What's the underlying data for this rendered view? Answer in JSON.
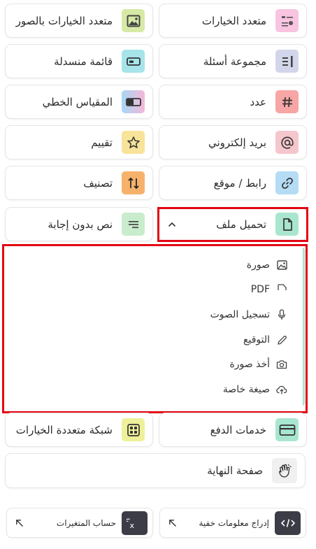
{
  "question_types": {
    "multiple_choice": {
      "label": "متعدد الخيارات",
      "icon": "multiple-choice-icon",
      "color": "#f8c4e0"
    },
    "picture_choice": {
      "label": "متعدد الخيارات بالصور",
      "icon": "image-icon",
      "color": "#d6eaa6"
    },
    "question_group": {
      "label": "مجموعة أسئلة",
      "icon": "question-group-icon",
      "color": "#d3d6ea"
    },
    "dropdown": {
      "label": "قائمة منسدلة",
      "icon": "dropdown-icon",
      "color": "#a6e4ea"
    },
    "number": {
      "label": "عدد",
      "icon": "hash-icon",
      "color": "#f8a5a5"
    },
    "linear_scale": {
      "label": "المقياس الخطي",
      "icon": "linear-scale-icon"
    },
    "email": {
      "label": "بريد إلكتروني",
      "icon": "at-icon",
      "color": "#f5c6cc"
    },
    "rating": {
      "label": "تقييم",
      "icon": "star-icon",
      "color": "#f8e39a"
    },
    "url": {
      "label": "رابط / موقع",
      "icon": "link-icon",
      "color": "#b5dcf5"
    },
    "ranking": {
      "label": "تصنيف",
      "icon": "sort-arrows-icon",
      "color": "#f6b26b"
    },
    "file_upload": {
      "label": "تحميل ملف",
      "icon": "file-icon",
      "color": "#a8e6cf",
      "expanded": true
    },
    "statement": {
      "label": "نص بدون إجابة",
      "icon": "text-lines-icon",
      "color": "#c8eccc"
    }
  },
  "file_upload_options": [
    {
      "label": "صورة",
      "icon": "image-icon"
    },
    {
      "label": "PDF",
      "icon": "pdf-icon"
    },
    {
      "label": "تسجيل الصوت",
      "icon": "microphone-icon"
    },
    {
      "label": "التوقيع",
      "icon": "pencil-icon"
    },
    {
      "label": "أخذ صورة",
      "icon": "camera-icon"
    },
    {
      "label": "صيغة خاصة",
      "icon": "cloud-upload-icon"
    }
  ],
  "more_types": {
    "payment": {
      "label": "خدمات الدفع",
      "icon": "credit-card-icon",
      "color": "#a8e6cf"
    },
    "matrix": {
      "label": "شبكة متعددة الخيارات",
      "icon": "grid-icon",
      "color": "#eef09a"
    },
    "end_page": {
      "label": "صفحة النهاية",
      "icon": "waving-hand-icon",
      "color": "#f0f0f0"
    }
  },
  "external": {
    "hidden_fields": {
      "label": "إدراج معلومات خفية",
      "icon": "code-icon"
    },
    "variables": {
      "label": "حساب المتغيرات",
      "icon": "function-icon"
    }
  }
}
